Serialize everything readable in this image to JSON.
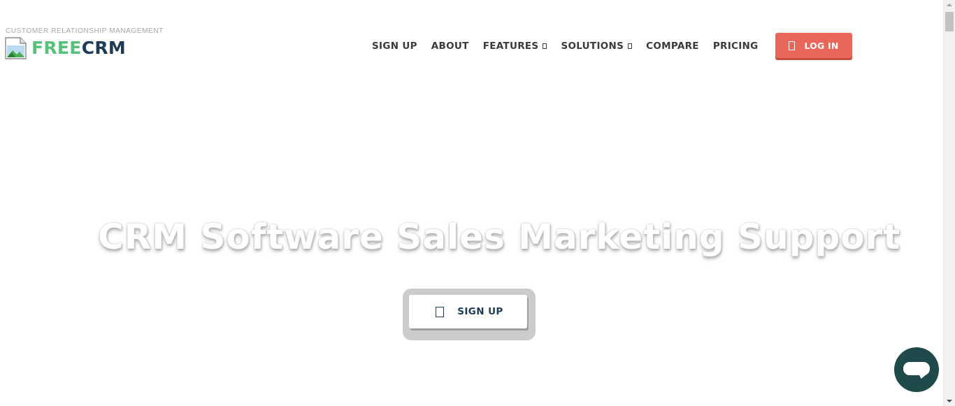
{
  "header": {
    "tagline": "CUSTOMER RELATIONSHIP MANAGEMENT",
    "logo": {
      "part1": "FREE",
      "part2": "CRM",
      "icon": "broken-image-icon"
    }
  },
  "nav": {
    "items": [
      {
        "label": "SIGN UP",
        "dropdown": false
      },
      {
        "label": "ABOUT",
        "dropdown": false
      },
      {
        "label": "FEATURES",
        "dropdown": true
      },
      {
        "label": "SOLUTIONS",
        "dropdown": true
      },
      {
        "label": "COMPARE",
        "dropdown": false
      },
      {
        "label": "PRICING",
        "dropdown": false
      }
    ],
    "login": {
      "label": "LOG IN",
      "icon": "missing-glyph-icon",
      "color": "#e8675a"
    }
  },
  "hero": {
    "title": "CRM Software Sales Marketing Support",
    "button": {
      "label": "SIGN UP",
      "icon": "missing-glyph-icon"
    }
  },
  "chat": {
    "icon": "chat-bubble-icon",
    "color": "#1e4a4b"
  },
  "colors": {
    "brand_green": "#56c27a",
    "brand_navy": "#1d3b57",
    "nav_text": "#3a3a3a"
  }
}
